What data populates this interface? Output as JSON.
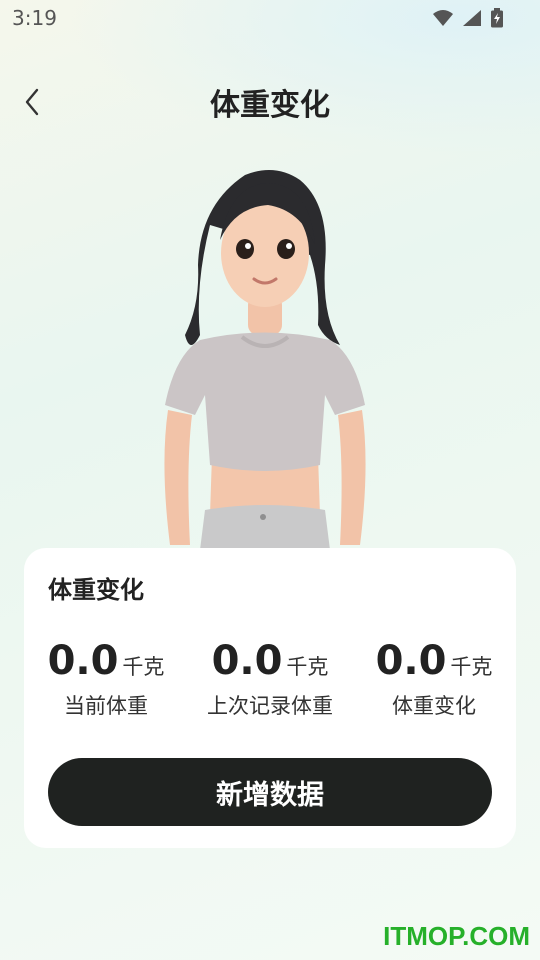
{
  "status_bar": {
    "time": "3:19"
  },
  "header": {
    "title": "体重变化"
  },
  "card": {
    "title": "体重变化",
    "stats": [
      {
        "value": "0.0",
        "unit": "千克",
        "label": "当前体重"
      },
      {
        "value": "0.0",
        "unit": "千克",
        "label": "上次记录体重"
      },
      {
        "value": "0.0",
        "unit": "千克",
        "label": "体重变化"
      }
    ],
    "add_button_label": "新增数据"
  },
  "watermark": "ITMOP.COM",
  "colors": {
    "button_bg": "#1f2220",
    "watermark": "#26b02a",
    "card_bg": "#ffffff"
  }
}
